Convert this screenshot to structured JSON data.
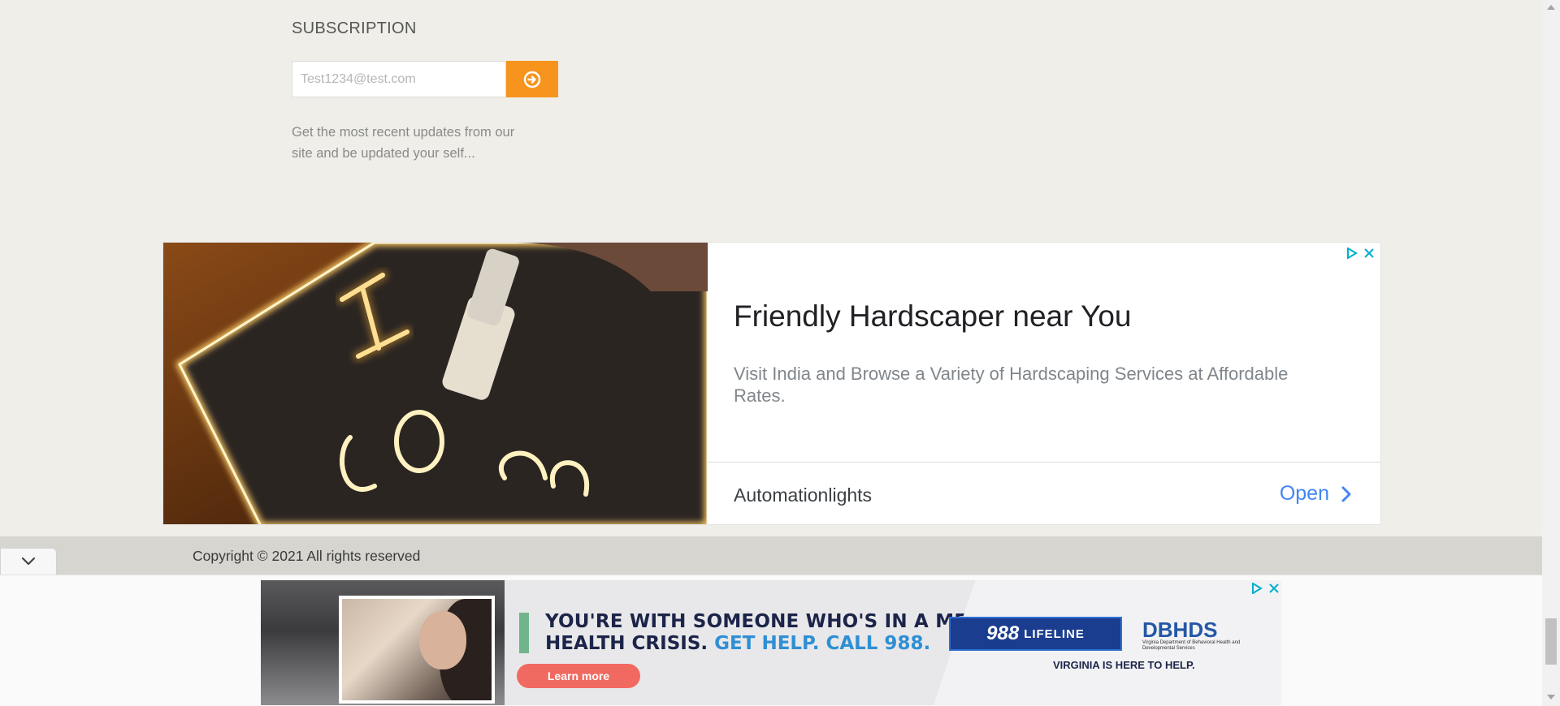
{
  "subscription": {
    "title": "SUBSCRIPTION",
    "email_placeholder": "Test1234@test.com",
    "submit_icon": "arrow-circle-right-icon",
    "description": "Get the most recent updates from our site and be updated your self..."
  },
  "ad_banner": {
    "headline": "Friendly Hardscaper near You",
    "description": "Visit India and Browse a Variety of Hardscaping Services at Affordable Rates.",
    "advertiser": "Automationlights",
    "cta": "Open",
    "image_text": "I Lo"
  },
  "footer": {
    "copyright": "Copyright © 2021 All rights reserved"
  },
  "bottom_ad": {
    "headline_line1": "YOU'RE WITH SOMEONE WHO'S IN A MENTAL",
    "headline_line2_plain": "HEALTH CRISIS.",
    "headline_line2_highlight": "GET HELP. CALL 988.",
    "cta": "Learn more",
    "lifeline_number": "988",
    "lifeline_label": "LIFELINE",
    "org": "DBHDS",
    "org_sub": "Virginia Department of Behavioral Health and Developmental Services",
    "tagline": "VIRGINIA IS HERE TO HELP."
  },
  "colors": {
    "page_bg": "#efeee9",
    "accent_orange": "#f7941d",
    "link_blue": "#4285f4",
    "footer_bar": "#d6d5d0"
  }
}
